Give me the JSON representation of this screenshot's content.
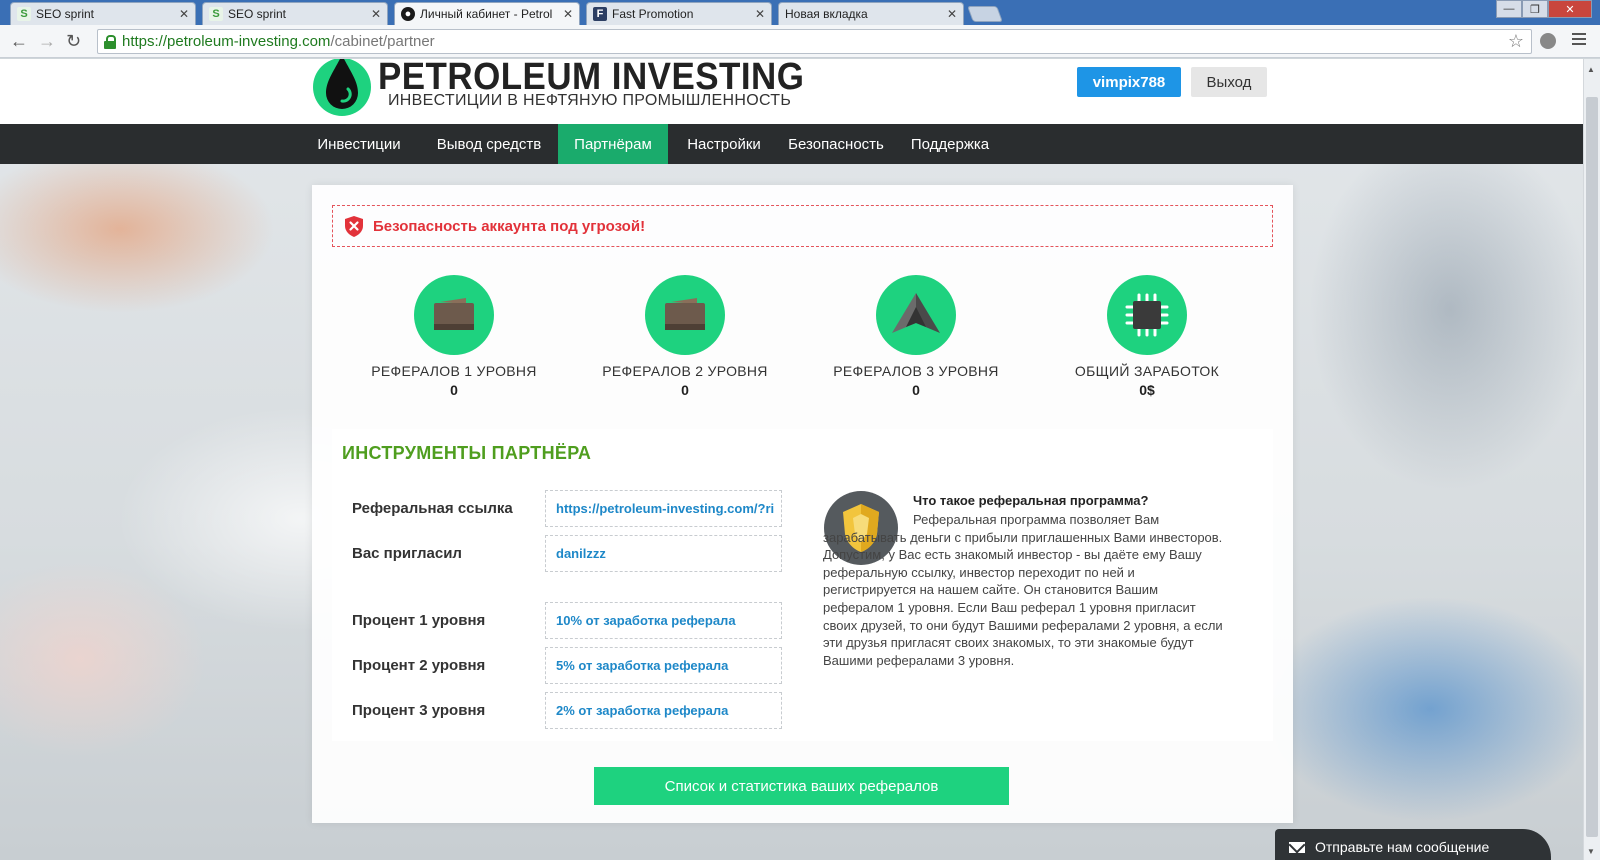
{
  "browser": {
    "tabs": [
      {
        "label": "SEO sprint",
        "favicon": "seo-sprint-icon"
      },
      {
        "label": "SEO sprint",
        "favicon": "seo-sprint-icon"
      },
      {
        "label": "Личный кабинет - Petrol",
        "favicon": "oil-drop-icon"
      },
      {
        "label": "Fast Promotion",
        "favicon": "fast-promotion-icon"
      },
      {
        "label": "Новая вкладка",
        "favicon": ""
      }
    ],
    "active_tab": 2,
    "url_scheme_host": "https://petroleum-investing.com",
    "url_path": "/cabinet/partner"
  },
  "header": {
    "logo_title": "PETROLEUM INVESTING",
    "logo_subtitle": "ИНВЕСТИЦИИ В НЕФТЯНУЮ ПРОМЫШЛЕННОСТЬ",
    "username": "vimpix788",
    "logout_label": "Выход"
  },
  "nav": {
    "items": [
      {
        "label": "Инвестиции"
      },
      {
        "label": "Вывод средств"
      },
      {
        "label": "Партнёрам"
      },
      {
        "label": "Настройки"
      },
      {
        "label": "Безопасность"
      },
      {
        "label": "Поддержка"
      }
    ],
    "active": 2
  },
  "alert": {
    "text": "Безопасность аккаунта под угрозой!"
  },
  "stats": [
    {
      "label": "РЕФЕРАЛОВ 1 УРОВНЯ",
      "value": "0",
      "icon": "wallet-icon"
    },
    {
      "label": "РЕФЕРАЛОВ 2 УРОВНЯ",
      "value": "0",
      "icon": "wallet-icon"
    },
    {
      "label": "РЕФЕРАЛОВ 3 УРОВНЯ",
      "value": "0",
      "icon": "pyramid-icon"
    },
    {
      "label": "ОБЩИЙ ЗАРАБОТОК",
      "value": "0$",
      "icon": "chip-icon"
    }
  ],
  "tools": {
    "title": "ИНСТРУМЕНТЫ ПАРТНЁРА",
    "fields": [
      {
        "label": "Реферальная ссылка",
        "value": "https://petroleum-investing.com/?ri"
      },
      {
        "label": "Вас пригласил",
        "value": "danilzzz"
      },
      {
        "label": "Процент 1 уровня",
        "value": "10% от заработка реферала"
      },
      {
        "label": "Процент 2 уровня",
        "value": "5% от заработка реферала"
      },
      {
        "label": "Процент 3 уровня",
        "value": "2% от заработка реферала"
      }
    ],
    "info_title": "Что такое реферальная программа?",
    "info_text": "Реферальная программа позволяет Вам зарабатывать деньги с прибыли приглашенных Вами инвесторов. Допустим, у Вас есть знакомый инвестор - вы даёте ему Вашу реферальную ссылку, инвестор переходит по ней и регистрируется на нашем сайте. Он становится Вашим рефералом 1 уровня. Если Ваш реферал 1 уровня пригласит своих друзей, то они будут Вашими рефералами 2 уровня, а если эти друзья пригласят своих знакомых, то эти знакомые будут Вашими рефералами 3 уровня."
  },
  "cta_label": "Список и статистика ваших рефералов",
  "chat_label": "Отправьте нам сообщение",
  "colors": {
    "accent_green": "#1ed27f",
    "nav_active": "#1aab6c",
    "nav_bg": "#2a2d2f",
    "user_blue": "#1e95e6",
    "alert_red": "#e2323a",
    "title_green": "#4f9e1f",
    "link_blue": "#1e88c8"
  }
}
